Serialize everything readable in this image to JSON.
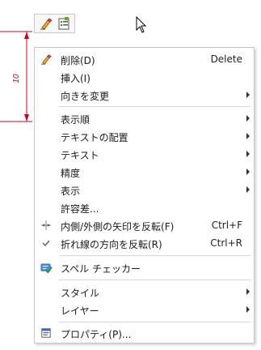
{
  "drawing": {
    "dimension_value": "10"
  },
  "menu": {
    "items": [
      {
        "label": "削除(D)",
        "shortcut": "Delete",
        "icon": "eraser-icon"
      },
      {
        "label": "挿入(I)"
      },
      {
        "label": "向きを変更",
        "submenu": true
      },
      {
        "label": "表示順",
        "submenu": true
      },
      {
        "label": "テキストの配置",
        "submenu": true
      },
      {
        "label": "テキスト",
        "submenu": true
      },
      {
        "label": "精度",
        "submenu": true
      },
      {
        "label": "表示",
        "submenu": true
      },
      {
        "label": "許容差..."
      },
      {
        "label": "内側/外側の矢印を反転(F)",
        "shortcut": "Ctrl+F",
        "icon": "flip-arrows-icon"
      },
      {
        "label": "折れ線の方向を反転(R)",
        "shortcut": "Ctrl+R",
        "icon": "checkmark-icon"
      },
      {
        "label": "スペル チェッカー",
        "icon": "spell-check-icon"
      },
      {
        "label": "スタイル",
        "submenu": true
      },
      {
        "label": "レイヤー",
        "submenu": true
      },
      {
        "label": "プロパティ(P)...",
        "icon": "properties-icon"
      }
    ]
  },
  "colors": {
    "dimension_red": "#d0021b",
    "checkmark": "#666666"
  }
}
